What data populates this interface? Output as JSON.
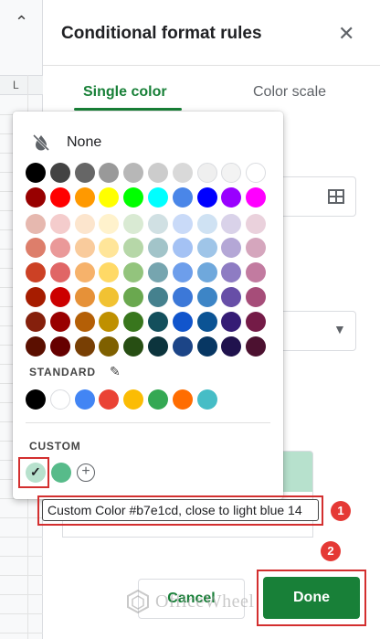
{
  "sheet": {
    "collapse_icon": "chevron-up-icon",
    "column_label": "L"
  },
  "panel": {
    "title": "Conditional format rules",
    "close_icon": "close-icon",
    "tabs": [
      {
        "label": "Single color",
        "active": true
      },
      {
        "label": "Color scale",
        "active": false
      }
    ],
    "preview_color": "#b7e1cd"
  },
  "color_picker": {
    "none_label": "None",
    "none_icon": "format-color-reset-icon",
    "palette_rows": [
      [
        "#000000",
        "#434343",
        "#666666",
        "#999999",
        "#b7b7b7",
        "#cccccc",
        "#d9d9d9",
        "#efefef",
        "#f3f3f3",
        "#ffffff"
      ],
      [
        "#980000",
        "#ff0000",
        "#ff9900",
        "#ffff00",
        "#00ff00",
        "#00ffff",
        "#4a86e8",
        "#0000ff",
        "#9900ff",
        "#ff00ff"
      ],
      [
        "#e6b8af",
        "#f4cccc",
        "#fce5cd",
        "#fff2cc",
        "#d9ead3",
        "#d0e0e3",
        "#c9daf8",
        "#cfe2f3",
        "#d9d2e9",
        "#ead1dc"
      ],
      [
        "#dd7e6b",
        "#ea9999",
        "#f9cb9c",
        "#ffe599",
        "#b6d7a8",
        "#a2c4c9",
        "#a4c2f4",
        "#9fc5e8",
        "#b4a7d6",
        "#d5a6bd"
      ],
      [
        "#cc4125",
        "#e06666",
        "#f6b26b",
        "#ffd966",
        "#93c47d",
        "#76a5af",
        "#6d9eeb",
        "#6fa8dc",
        "#8e7cc3",
        "#c27ba0"
      ],
      [
        "#a61c00",
        "#cc0000",
        "#e69138",
        "#f1c232",
        "#6aa84f",
        "#45818e",
        "#3c78d8",
        "#3d85c6",
        "#674ea7",
        "#a64d79"
      ],
      [
        "#85200c",
        "#990000",
        "#b45f06",
        "#bf9000",
        "#38761d",
        "#134f5c",
        "#1155cc",
        "#0b5394",
        "#351c75",
        "#741b47"
      ],
      [
        "#5b0f00",
        "#660000",
        "#783f04",
        "#7f6000",
        "#274e13",
        "#0c343d",
        "#1c4587",
        "#073763",
        "#20124d",
        "#4c1130"
      ]
    ],
    "standard_label": "STANDARD",
    "standard_colors": [
      "#000000",
      "#ffffff",
      "#4285f4",
      "#ea4335",
      "#fbbc04",
      "#34a853",
      "#ff6d01",
      "#46bdc6"
    ],
    "custom_label": "CUSTOM",
    "custom_colors": [
      "#b7e1cd",
      "#57bb8a"
    ],
    "selected_custom_index": 0
  },
  "tooltip": {
    "text": "Custom Color #b7e1cd, close to light blue 14"
  },
  "annotations": {
    "step1": "1",
    "step2": "2",
    "highlight_color": "#d32f2f",
    "badge_color": "#e53935"
  },
  "buttons": {
    "cancel": "Cancel",
    "done": "Done",
    "accent": "#188038"
  },
  "watermark": {
    "text": "OfficeWheel"
  }
}
